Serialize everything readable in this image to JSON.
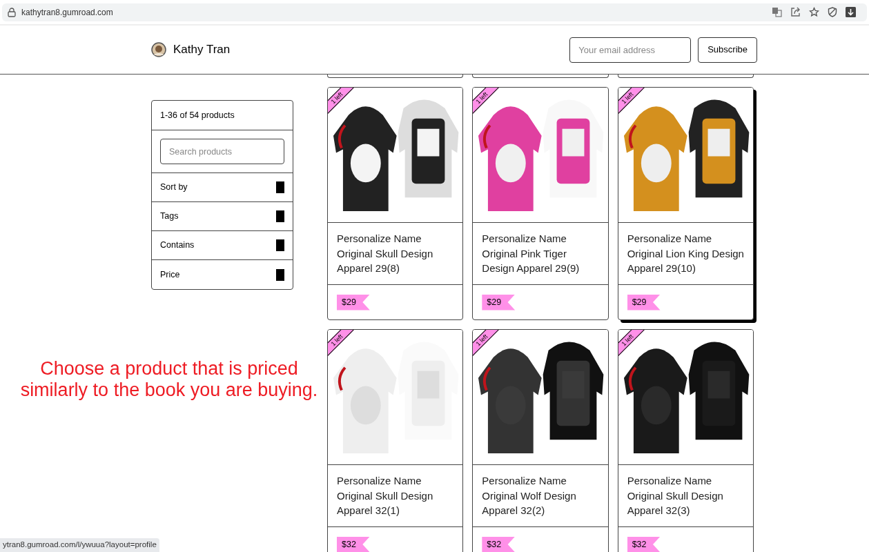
{
  "browser": {
    "url": "kathytran8.gumroad.com",
    "status_url": "ytran8.gumroad.com/l/ywuua?layout=profile"
  },
  "header": {
    "name": "Kathy Tran",
    "email": {
      "placeholder": "Your email address"
    },
    "subscribe": "Subscribe"
  },
  "filters": {
    "count": "1-36 of 54 products",
    "search": {
      "placeholder": "Search products"
    },
    "sections": [
      "Sort by",
      "Tags",
      "Contains",
      "Price"
    ]
  },
  "products": [
    {
      "title": "Personalize Name Original Skull Design Apparel 29(8)",
      "price": "$29",
      "ribbon": "1 left",
      "hovered": false
    },
    {
      "title": "Personalize Name Original Pink Tiger Design Apparel 29(9)",
      "price": "$29",
      "ribbon": "1 left",
      "hovered": false
    },
    {
      "title": "Personalize Name Original Lion King Design Apparel 29(10)",
      "price": "$29",
      "ribbon": "1 left",
      "hovered": true
    },
    {
      "title": "Personalize Name Original Skull Design Apparel 32(1)",
      "price": "$32",
      "ribbon": "1 left",
      "hovered": false
    },
    {
      "title": "Personalize Name Original Wolf Design Apparel 32(2)",
      "price": "$32",
      "ribbon": "1 left",
      "hovered": false
    },
    {
      "title": "Personalize Name Original Skull Design Apparel 32(3)",
      "price": "$32",
      "ribbon": "1 left",
      "hovered": false
    }
  ],
  "annotation": "Choose a product that is priced similarly to the book you are buying."
}
